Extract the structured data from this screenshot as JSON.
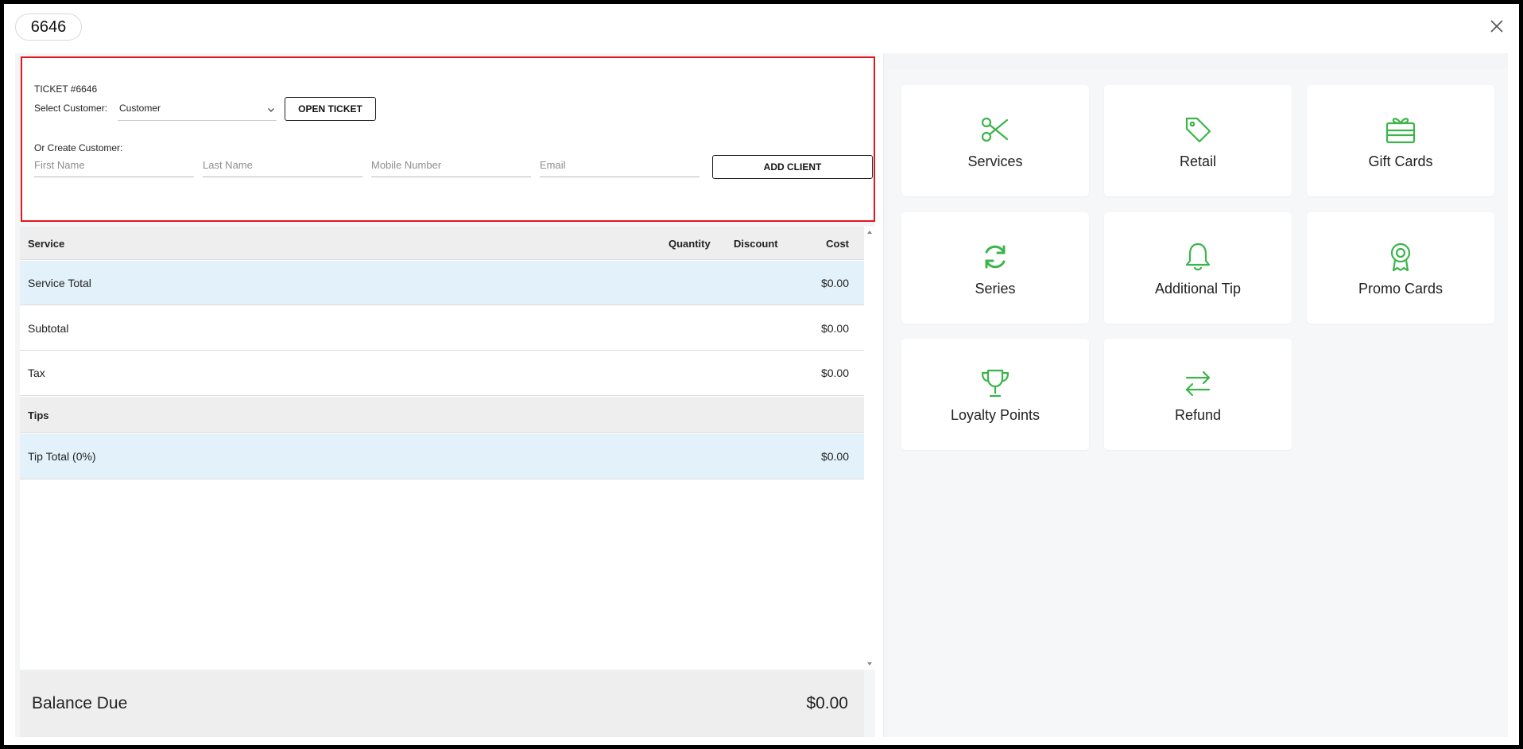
{
  "header": {
    "ticket_number": "6646"
  },
  "customer_section": {
    "ticket_label": "TICKET #6646",
    "select_label": "Select Customer:",
    "select_value": "Customer",
    "open_ticket_label": "OPEN TICKET",
    "create_label": "Or Create Customer:",
    "first_name_placeholder": "First Name",
    "last_name_placeholder": "Last Name",
    "mobile_placeholder": "Mobile Number",
    "email_placeholder": "Email",
    "add_client_label": "ADD CLIENT"
  },
  "table": {
    "headers": {
      "service": "Service",
      "quantity": "Quantity",
      "discount": "Discount",
      "cost": "Cost"
    },
    "rows": [
      {
        "label": "Service Total",
        "value": "$0.00"
      },
      {
        "label": "Subtotal",
        "value": "$0.00"
      },
      {
        "label": "Tax",
        "value": "$0.00"
      },
      {
        "label": "Tips",
        "value": ""
      },
      {
        "label": "Tip Total (0%)",
        "value": "$0.00"
      }
    ]
  },
  "balance": {
    "label": "Balance Due",
    "value": "$0.00"
  },
  "tiles": [
    {
      "label": "Services",
      "icon": "scissors-icon"
    },
    {
      "label": "Retail",
      "icon": "tag-icon"
    },
    {
      "label": "Gift Cards",
      "icon": "gift-card-icon"
    },
    {
      "label": "Series",
      "icon": "refresh-icon"
    },
    {
      "label": "Additional Tip",
      "icon": "bell-icon"
    },
    {
      "label": "Promo Cards",
      "icon": "award-icon"
    },
    {
      "label": "Loyalty Points",
      "icon": "trophy-icon"
    },
    {
      "label": "Refund",
      "icon": "swap-arrows-icon"
    }
  ],
  "colors": {
    "accent_green": "#3cb44b",
    "highlight_red": "#e3161d",
    "row_blue": "#e3f1fb"
  }
}
